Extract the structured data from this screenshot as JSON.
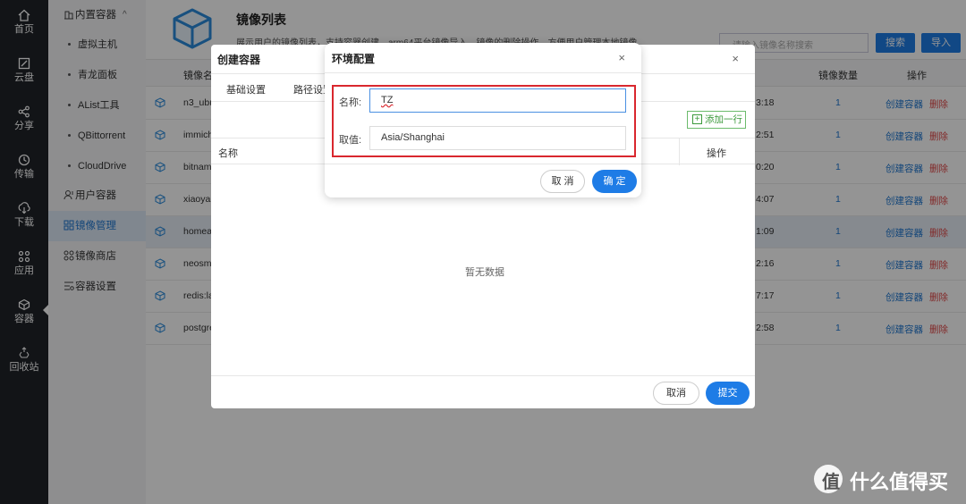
{
  "rail": {
    "items": [
      {
        "label": "首页",
        "icon": "home-icon"
      },
      {
        "label": "云盘",
        "icon": "cloud-disk-icon"
      },
      {
        "label": "分享",
        "icon": "share-icon"
      },
      {
        "label": "传输",
        "icon": "transfer-icon"
      },
      {
        "label": "下载",
        "icon": "download-icon"
      },
      {
        "label": "应用",
        "icon": "apps-icon"
      },
      {
        "label": "容器",
        "icon": "container-icon"
      },
      {
        "label": "回收站",
        "icon": "recycle-icon"
      }
    ]
  },
  "sidebar": {
    "group_label": "内置容器",
    "sub_items": [
      "虚拟主机",
      "青龙面板",
      "AList工具",
      "QBittorrent",
      "CloudDrive"
    ],
    "items": [
      "用户容器",
      "镜像管理",
      "镜像商店",
      "容器设置"
    ],
    "active": "镜像管理"
  },
  "header": {
    "title": "镜像列表",
    "description": "展示用户的镜像列表，支持容器创建，arm64平台镜像导入，镜像的删除操作，方便用户管理本地镜像",
    "search_placeholder": "请输入镜像名称搜索",
    "search_button": "搜索",
    "import_button": "导入"
  },
  "table": {
    "columns": [
      "镜像名",
      "镜像数量",
      "操作"
    ],
    "rows": [
      {
        "name": "n3_ubu",
        "time": "3:18",
        "count": "1"
      },
      {
        "name": "immich",
        "time": "2:51",
        "count": "1"
      },
      {
        "name": "bitnam",
        "time": "0:20",
        "count": "1"
      },
      {
        "name": "xiaoyal",
        "time": "4:07",
        "count": "1"
      },
      {
        "name": "homea",
        "time": "1:09",
        "count": "1"
      },
      {
        "name": "neosm",
        "time": "2:16",
        "count": "1"
      },
      {
        "name": "redis:la",
        "time": "7:17",
        "count": "1"
      },
      {
        "name": "postgre",
        "time": "2:58",
        "count": "1"
      }
    ],
    "action_create": "创建容器",
    "action_delete": "删除"
  },
  "create_dialog": {
    "title": "创建容器",
    "tabs": [
      "基础设置",
      "路径设置"
    ],
    "add_row_label": "添加一行",
    "col_name": "名称",
    "col_action": "操作",
    "empty_text": "暂无数据",
    "cancel": "取消",
    "submit": "提交"
  },
  "env_dialog": {
    "title": "环境配置",
    "name_label": "名称:",
    "name_value": "TZ",
    "value_label": "取值:",
    "value_value": "Asia/Shanghai",
    "cancel": "取 消",
    "confirm": "确 定"
  },
  "watermark": {
    "text": "什么值得买",
    "logo_glyph": "值"
  },
  "colors": {
    "accent": "#1e7ce6",
    "danger": "#e04848",
    "highlight": "#d9272e",
    "rail_bg": "#1f2329"
  }
}
